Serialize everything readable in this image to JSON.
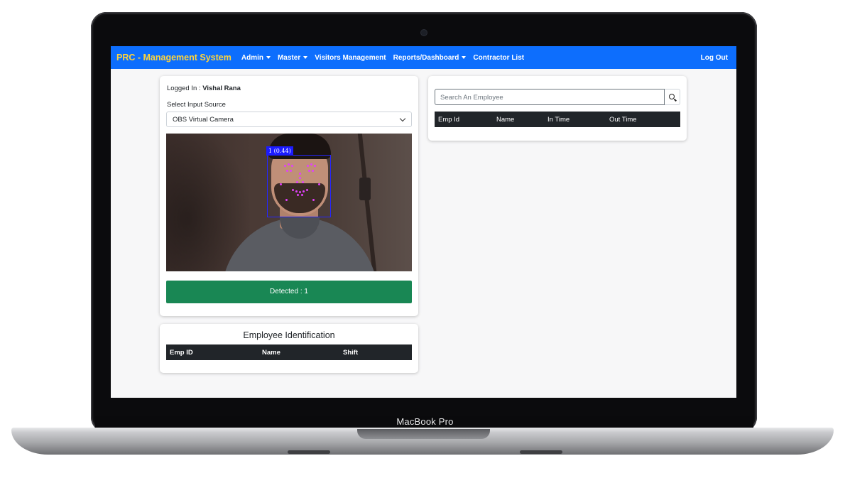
{
  "device": {
    "label": "MacBook Pro"
  },
  "navbar": {
    "brand": "PRC - Management System",
    "items": [
      {
        "label": "Admin",
        "dropdown": true
      },
      {
        "label": "Master",
        "dropdown": true
      },
      {
        "label": "Visitors Management",
        "dropdown": false
      },
      {
        "label": "Reports/Dashboard",
        "dropdown": true
      },
      {
        "label": "Contractor List",
        "dropdown": false
      }
    ],
    "logout": "Log Out",
    "bg_color": "#0d6efd",
    "brand_color": "#ffd43b"
  },
  "camera_panel": {
    "logged_in_label": "Logged In :",
    "user_name": "Vishal Rana",
    "input_source_label": "Select Input Source",
    "input_source_value": "OBS Virtual Camera",
    "face_tag": "1 (0.44)",
    "detected_label": "Detected : 1",
    "detected_color": "#198754",
    "box_color": "#2626ff",
    "landmark_color": "#e040fb"
  },
  "employee_identification": {
    "title": "Employee Identification",
    "columns": [
      "Emp ID",
      "Name",
      "Shift"
    ],
    "rows": []
  },
  "search_panel": {
    "placeholder": "Search An Employee",
    "icon": "search-icon",
    "columns": [
      "Emp Id",
      "Name",
      "In Time",
      "Out Time"
    ],
    "rows": []
  }
}
